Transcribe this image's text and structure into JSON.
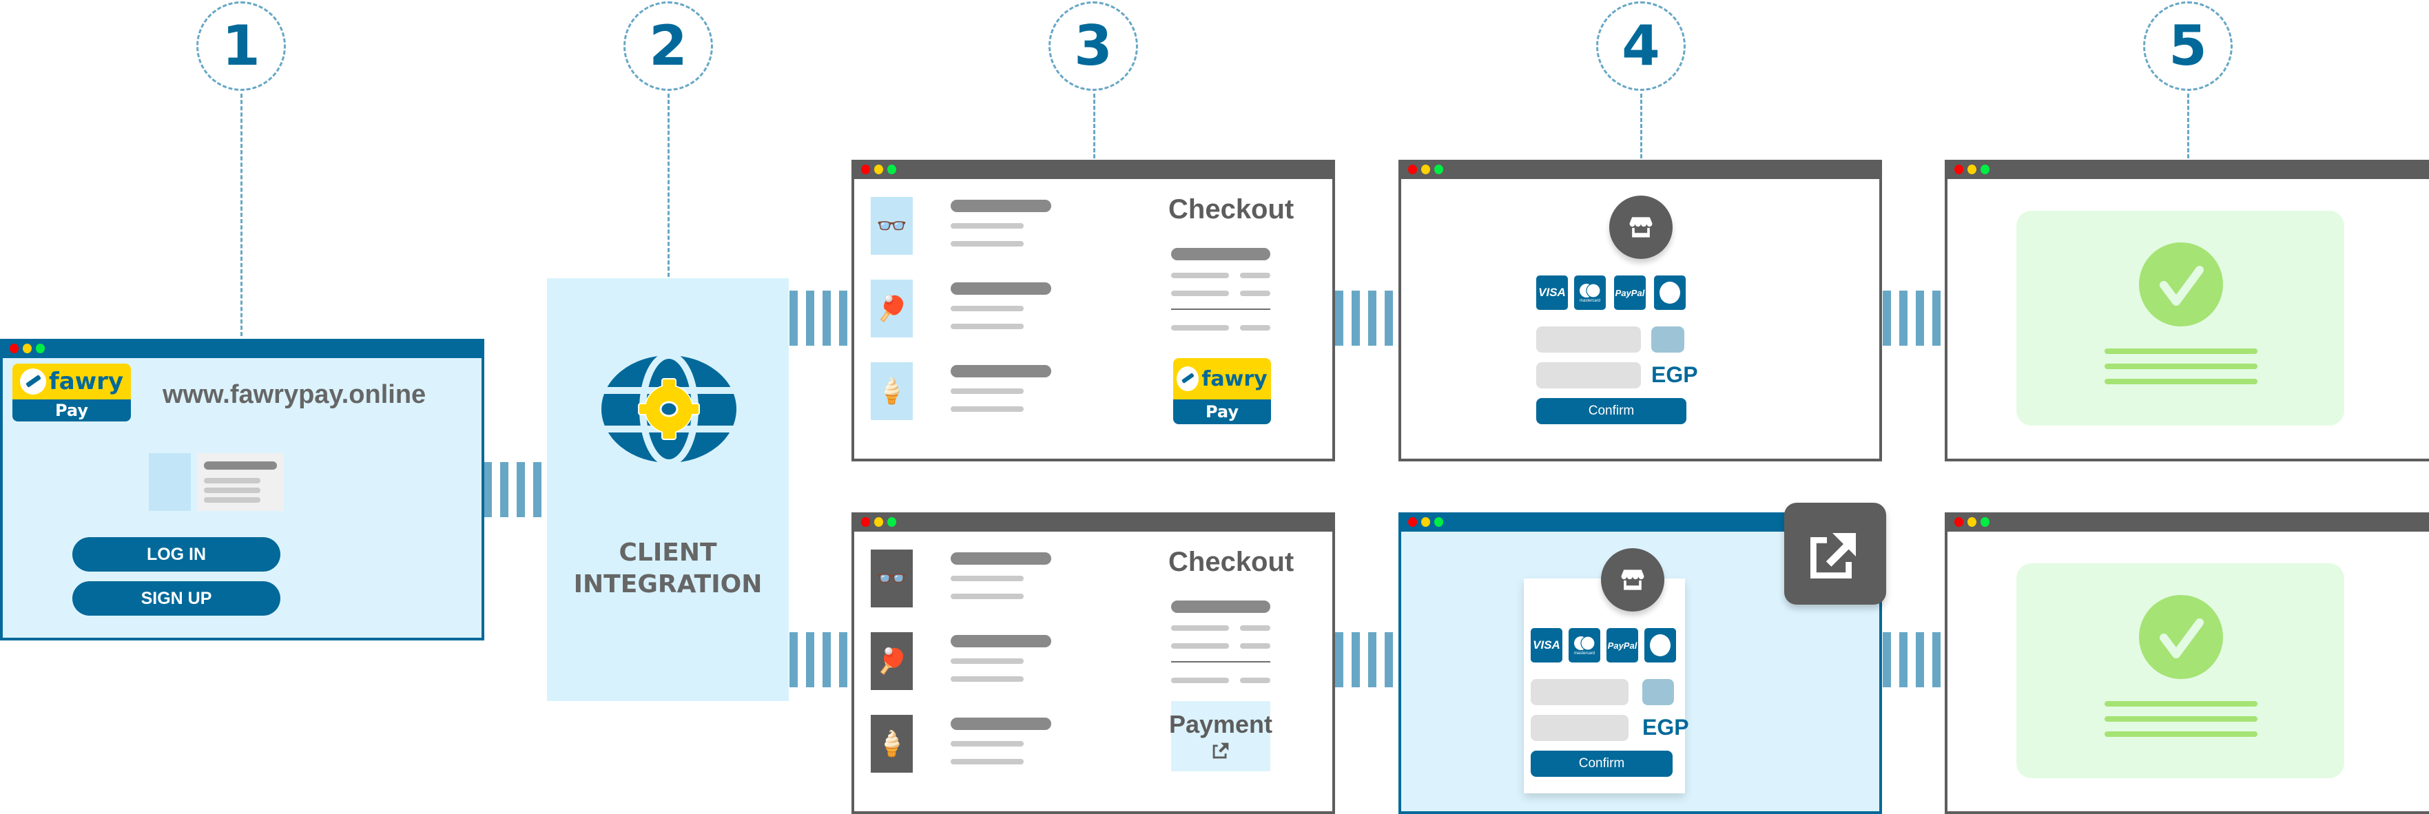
{
  "steps": [
    {
      "number": "1"
    },
    {
      "number": "2"
    },
    {
      "number": "3"
    },
    {
      "number": "4"
    },
    {
      "number": "5"
    }
  ],
  "colors": {
    "brand_blue": "#02699a",
    "light_blue": "#dcf3fd",
    "connector": "#67a7c5",
    "dark_gray": "#5d5d5d",
    "fawry_yellow": "#ffd600",
    "success_green": "#a5e374",
    "success_bg": "#e3fbe3"
  },
  "step1_portal": {
    "logo": {
      "brand": "fawry",
      "sub": "Pay"
    },
    "url": "www.fawrypay.online",
    "login_button": "LOG IN",
    "signup_button": "SIGN UP"
  },
  "step2_integration": {
    "icon": "globe-gear-icon",
    "label_line1": "CLIENT",
    "label_line2": "INTEGRATION"
  },
  "step3_checkout_top": {
    "title": "Checkout",
    "products": [
      "glasses-icon",
      "ping-pong-icon",
      "ice-cream-icon"
    ],
    "pay_button": {
      "brand": "fawry",
      "sub": "Pay"
    }
  },
  "step3_checkout_bottom": {
    "title": "Checkout",
    "products": [
      "glasses-icon",
      "ping-pong-icon",
      "ice-cream-icon"
    ],
    "payment_link": "Payment"
  },
  "step4_payment": {
    "store_icon": "store-icon",
    "methods": [
      "VISA",
      "mastercard",
      "PayPal",
      "fawry"
    ],
    "currency": "EGP",
    "confirm_button": "Confirm"
  },
  "step4_payment_popup": {
    "store_icon": "store-icon",
    "methods": [
      "VISA",
      "mastercard",
      "PayPal",
      "fawry"
    ],
    "currency": "EGP",
    "confirm_button": "Confirm",
    "badge_icon": "external-link-icon"
  },
  "step5_success": {
    "icon": "check-circle-icon"
  }
}
